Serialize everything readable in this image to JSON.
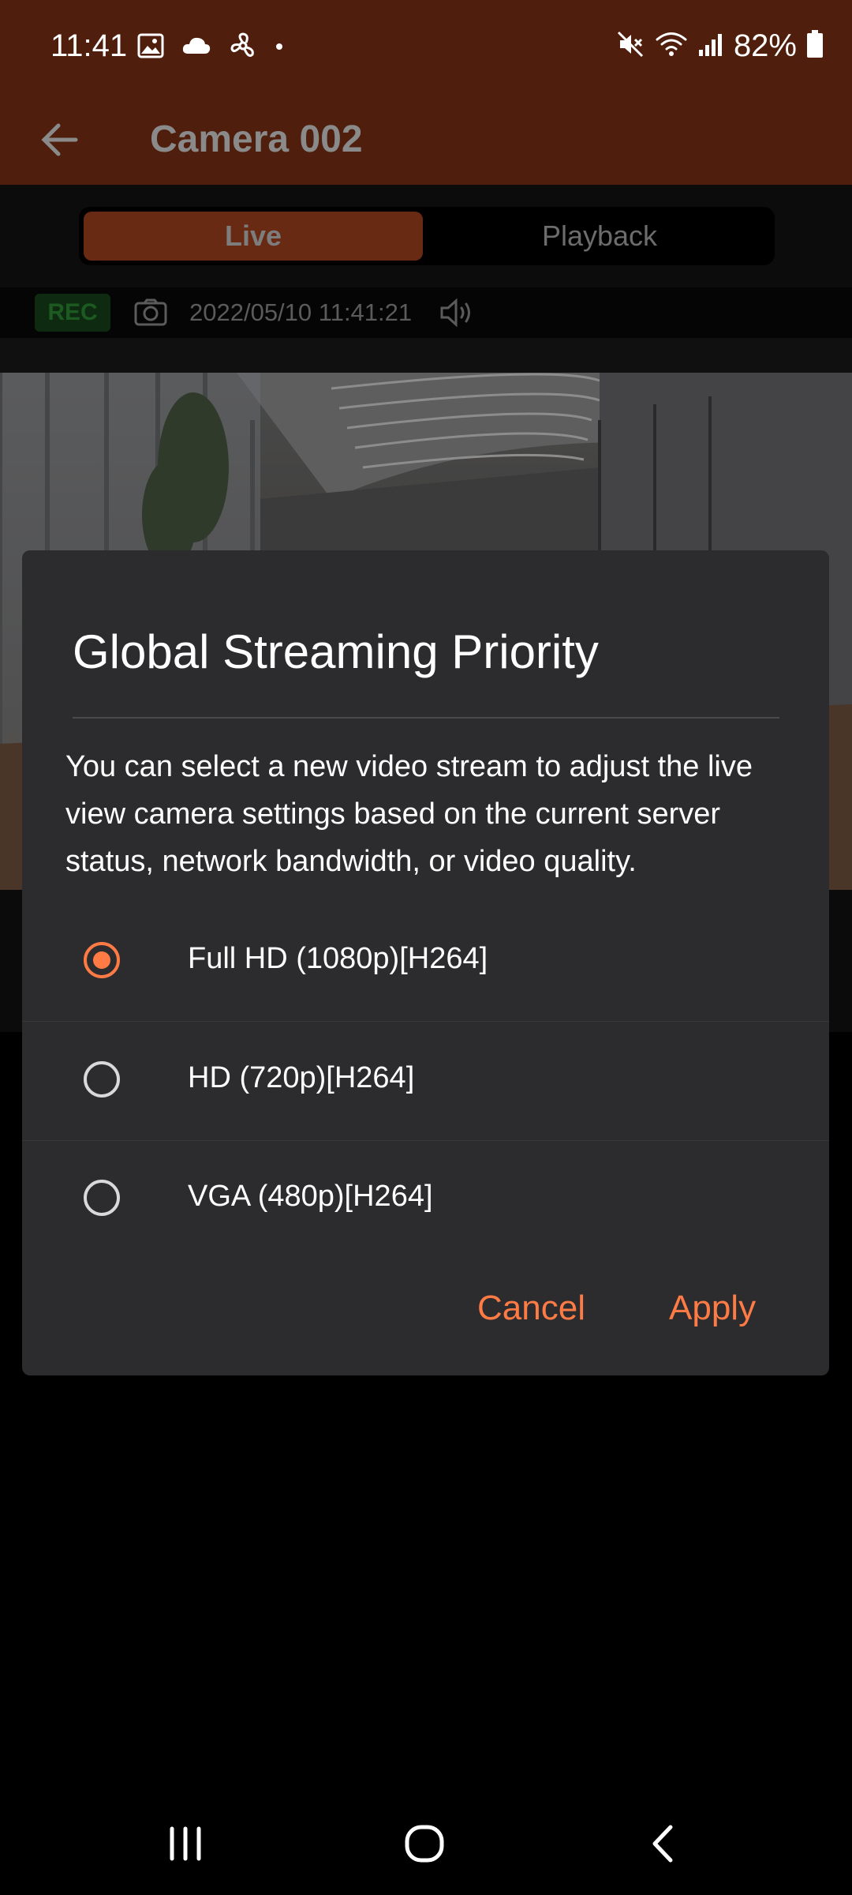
{
  "status_bar": {
    "time": "11:41",
    "battery": "82%",
    "icons": [
      "gallery-icon",
      "cloud-icon",
      "fan-icon",
      "dot-icon",
      "mute-icon",
      "wifi-icon",
      "signal-icon",
      "battery-icon"
    ]
  },
  "app_bar": {
    "title": "Camera 002"
  },
  "tabs": {
    "live": "Live",
    "playback": "Playback"
  },
  "info_strip": {
    "rec": "REC",
    "timestamp": "2022/05/10 11:41:21"
  },
  "dialog": {
    "title": "Global Streaming Priority",
    "message": "You can select a new video stream to adjust the live view camera settings based on the current server status, network bandwidth, or video quality.",
    "options": [
      {
        "label": "Full HD (1080p)[H264]",
        "selected": true
      },
      {
        "label": "HD (720p)[H264]",
        "selected": false
      },
      {
        "label": "VGA (480p)[H264]",
        "selected": false
      }
    ],
    "cancel": "Cancel",
    "apply": "Apply"
  },
  "colors": {
    "accent": "#ff7b46",
    "header": "#4f1e0c",
    "dialog_bg": "#2c2c2e"
  }
}
